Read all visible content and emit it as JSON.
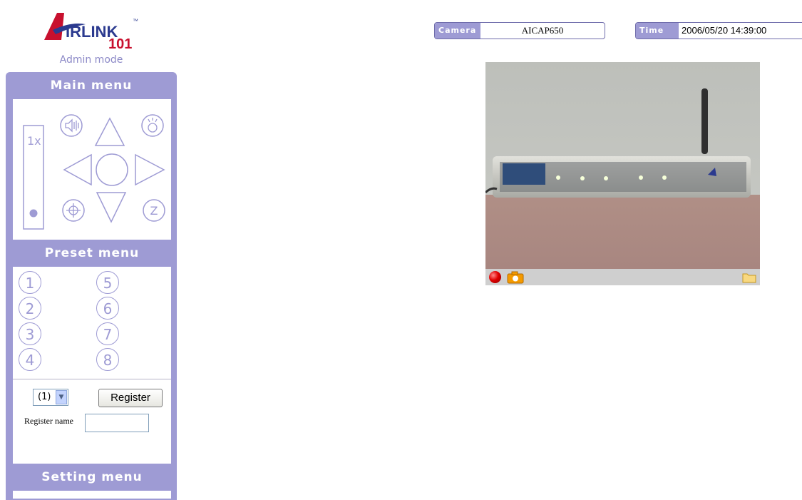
{
  "brand": {
    "logo_text": "AIRLINK 101",
    "admin_mode": "Admin mode"
  },
  "main_menu": {
    "title": "Main menu",
    "zoom_label": "1x",
    "zoom_level_fraction": 0.0,
    "icons": [
      "speaker-icon",
      "arrow-up-icon",
      "light-icon",
      "arrow-left-icon",
      "home-circle-icon",
      "arrow-right-icon",
      "focus-target-icon",
      "arrow-down-icon",
      "z-icon"
    ],
    "z_label": "Z"
  },
  "preset_menu": {
    "title": "Preset menu",
    "buttons": [
      "1",
      "5",
      "2",
      "6",
      "3",
      "7",
      "4",
      "8"
    ],
    "selected_preset": "(1)",
    "register_label": "Register",
    "register_name_label": "Register name",
    "register_name_value": ""
  },
  "setting_menu": {
    "title": "Setting menu"
  },
  "header": {
    "camera_label": "Camera",
    "camera_value": "AICAP650",
    "time_label": "Time",
    "time_value": "2006/05/20 14:39:00"
  },
  "colors": {
    "accent": "#9e9bd4",
    "record": "#e00000"
  }
}
